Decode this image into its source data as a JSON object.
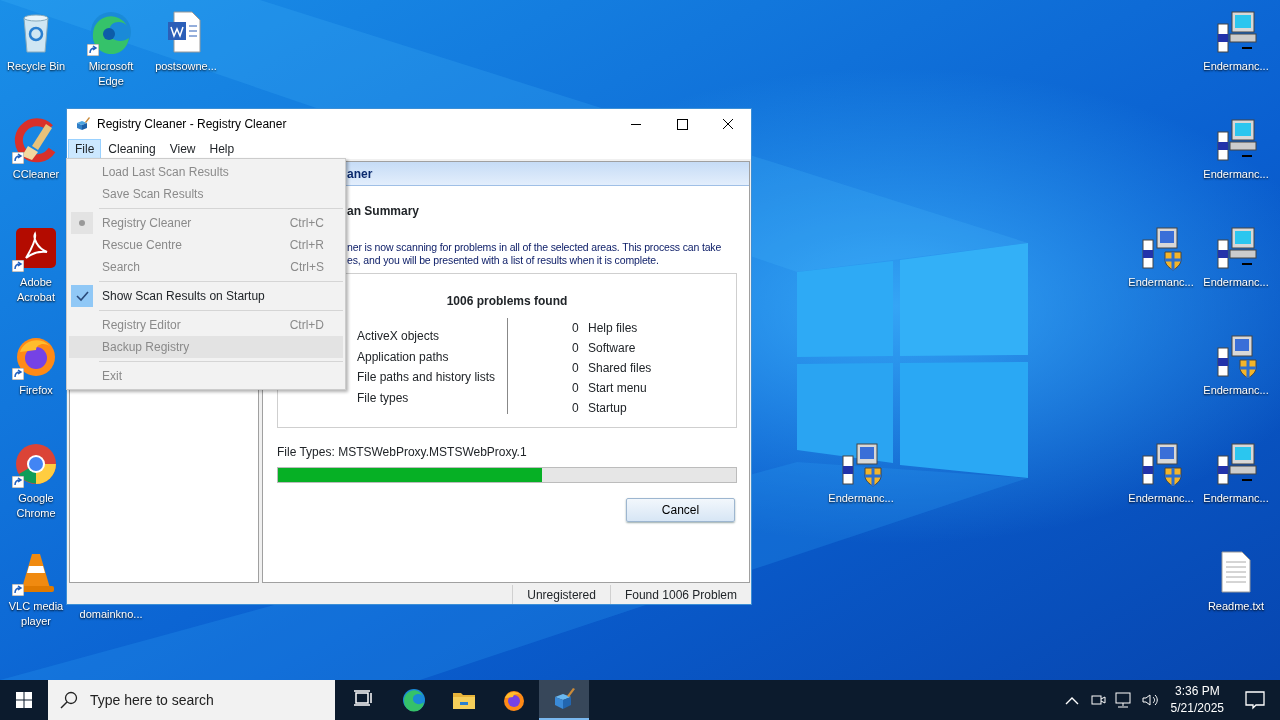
{
  "desktop_icons": [
    {
      "label": "Recycle Bin",
      "kind": "recycle",
      "shortcut": false
    },
    {
      "label": "Microsoft Edge",
      "kind": "edge",
      "shortcut": true
    },
    {
      "label": "postsowne...",
      "kind": "word",
      "shortcut": false
    },
    {
      "label": "CCleaner",
      "kind": "ccleaner",
      "shortcut": true
    },
    {
      "label": "Adobe Acrobat",
      "kind": "acrobat",
      "shortcut": true
    },
    {
      "label": "Firefox",
      "kind": "firefox",
      "shortcut": true
    },
    {
      "label": "Google Chrome",
      "kind": "chrome",
      "shortcut": true
    },
    {
      "label": "VLC media player",
      "kind": "vlc",
      "shortcut": true
    },
    {
      "label": "domainkno...",
      "shortcut": false
    },
    {
      "label": "Endermanc...",
      "kind": "installer",
      "shortcut": false
    },
    {
      "label": "Endermanc...",
      "kind": "installer",
      "shortcut": false
    },
    {
      "label": "Endermanc...",
      "kind": "setup",
      "shortcut": false
    },
    {
      "label": "Endermanc...",
      "kind": "installer",
      "shortcut": false
    },
    {
      "label": "Endermanc...",
      "kind": "setup",
      "shortcut": false
    },
    {
      "label": "Endermanc...",
      "kind": "setup",
      "shortcut": false
    },
    {
      "label": "Endermanc...",
      "kind": "setup",
      "shortcut": false
    },
    {
      "label": "Endermanc...",
      "kind": "installer",
      "shortcut": false
    },
    {
      "label": "Readme.txt",
      "kind": "text",
      "shortcut": false
    }
  ],
  "window": {
    "title": "Registry Cleaner - Registry Cleaner",
    "menu_bar": [
      {
        "label": "File",
        "selected": true
      },
      {
        "label": "Cleaning",
        "selected": false
      },
      {
        "label": "View",
        "selected": false
      },
      {
        "label": "Help",
        "selected": false
      }
    ],
    "file_menu": [
      {
        "kind": "item",
        "label": "Load Last Scan Results",
        "disabled": true,
        "checked": false,
        "selected": false
      },
      {
        "kind": "item",
        "label": "Save Scan Results",
        "disabled": true,
        "checked": false,
        "selected": false
      },
      {
        "kind": "separator"
      },
      {
        "kind": "radio",
        "label": "Registry Cleaner",
        "shortcut": "Ctrl+C",
        "disabled": true,
        "checked": true,
        "selected": false
      },
      {
        "kind": "item",
        "label": "Rescue Centre",
        "shortcut": "Ctrl+R",
        "disabled": true,
        "checked": false,
        "selected": false
      },
      {
        "kind": "item",
        "label": "Search",
        "shortcut": "Ctrl+S",
        "disabled": true,
        "checked": false,
        "selected": false
      },
      {
        "kind": "separator"
      },
      {
        "kind": "check",
        "label": "Show Scan Results on Startup",
        "disabled": false,
        "checked": true,
        "selected": false
      },
      {
        "kind": "separator"
      },
      {
        "kind": "item",
        "label": "Registry Editor",
        "shortcut": "Ctrl+D",
        "disabled": true,
        "checked": false,
        "selected": false
      },
      {
        "kind": "item",
        "label": "Backup Registry",
        "disabled": true,
        "checked": false,
        "selected": true
      },
      {
        "kind": "separator"
      },
      {
        "kind": "item",
        "label": "Exit",
        "disabled": true,
        "checked": false,
        "selected": false
      }
    ],
    "panel": {
      "header": "aner",
      "heading": "an Summary",
      "description": [
        "ner is now scanning for problems in all of the selected areas. This process can take",
        "es, and you will be presented with a list of results when it is complete."
      ],
      "results_title": "1006 problems found",
      "left_results": [
        {
          "label": "ActiveX objects"
        },
        {
          "label": "Application paths"
        },
        {
          "label": "File paths and history lists"
        },
        {
          "label": "File types"
        }
      ],
      "right_results": [
        {
          "count": "0",
          "label": "Help files"
        },
        {
          "count": "0",
          "label": "Software"
        },
        {
          "count": "0",
          "label": "Shared files"
        },
        {
          "count": "0",
          "label": "Start menu"
        },
        {
          "count": "0",
          "label": "Startup"
        }
      ],
      "current_item": "File Types: MSTSWebProxy.MSTSWebProxy.1",
      "progress": {
        "level": 0.576
      },
      "cancel_button": "Cancel"
    },
    "status_bar": [
      "Unregistered",
      "Found 1006 Problem"
    ]
  },
  "taskbar": {
    "search_placeholder": "Type here to search",
    "apps": [
      {
        "kind": "taskview",
        "selected": false
      },
      {
        "kind": "edge",
        "selected": false
      },
      {
        "kind": "folder",
        "selected": false
      },
      {
        "kind": "firefox",
        "selected": false
      },
      {
        "kind": "regcleaner",
        "selected": true
      }
    ],
    "time": "3:36 PM",
    "date": "5/21/2025"
  }
}
